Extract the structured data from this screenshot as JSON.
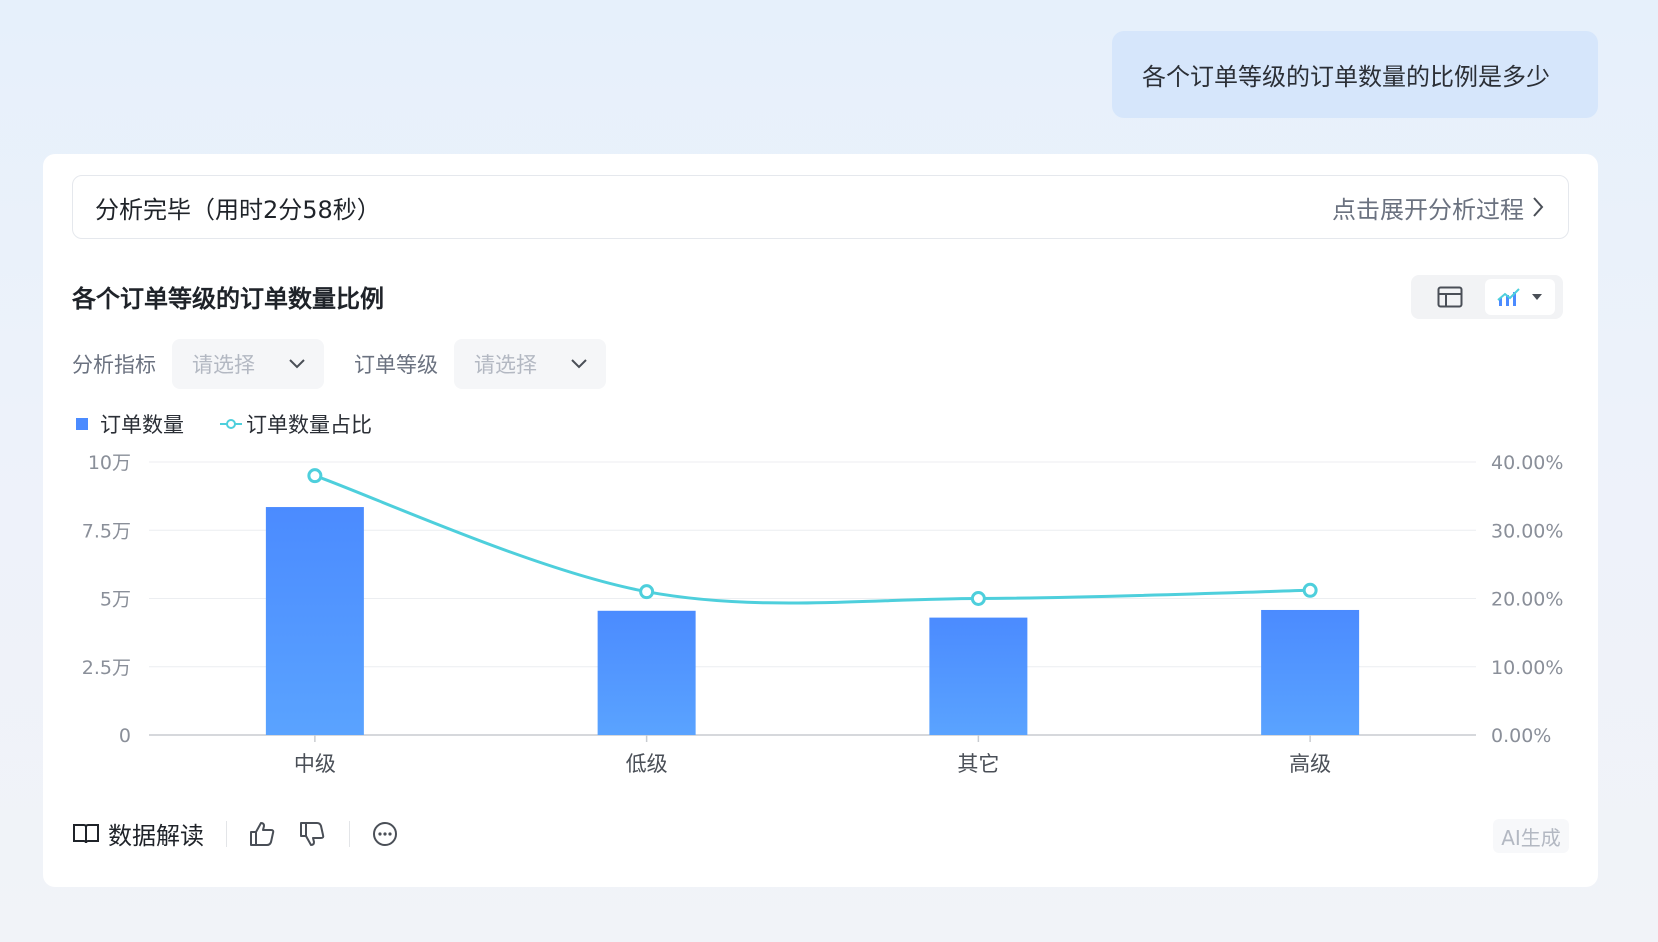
{
  "question": "各个订单等级的订单数量的比例是多少",
  "status": {
    "text": "分析完毕（用时2分58秒）",
    "expand_label": "点击展开分析过程"
  },
  "chart_title": "各个订单等级的订单数量比例",
  "filters": [
    {
      "label": "分析指标",
      "placeholder": "请选择"
    },
    {
      "label": "订单等级",
      "placeholder": "请选择"
    }
  ],
  "footer": {
    "interpret_label": "数据解读",
    "ai_label": "AI生成"
  },
  "colors": {
    "bar": "#4b8bff",
    "line": "#4ecfdc"
  },
  "icons": [
    "table-icon",
    "combo-chart-icon",
    "dropdown-caret-icon",
    "chevron-down-icon",
    "chevron-right-icon",
    "book-icon",
    "thumbs-up-icon",
    "thumbs-down-icon",
    "more-icon"
  ],
  "chart_data": {
    "type": "bar",
    "categories": [
      "中级",
      "低级",
      "其它",
      "高级"
    ],
    "series": [
      {
        "name": "订单数量",
        "type": "bar",
        "axis": "left",
        "values": [
          83500,
          45500,
          43000,
          45800
        ]
      },
      {
        "name": "订单数量占比",
        "type": "line",
        "axis": "right",
        "values": [
          38.0,
          21.0,
          20.0,
          21.2
        ]
      }
    ],
    "y_left": {
      "ticks": [
        0,
        25000,
        50000,
        75000,
        100000
      ],
      "tick_labels": [
        "0",
        "2.5万",
        "5万",
        "7.5万",
        "10万"
      ],
      "range": [
        0,
        100000
      ]
    },
    "y_right": {
      "tick_labels": [
        "0.00%",
        "10.00%",
        "20.00%",
        "30.00%",
        "40.00%"
      ],
      "range": [
        0,
        40
      ]
    },
    "grid": true,
    "legend_position": "top-left"
  }
}
